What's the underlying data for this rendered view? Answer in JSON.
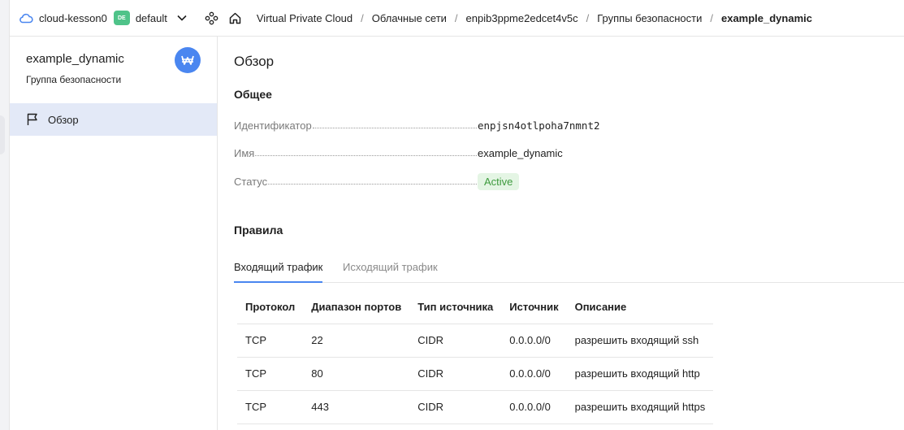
{
  "topbar": {
    "cloud_name": "cloud-kesson0",
    "folder_badge": "DE",
    "folder_name": "default",
    "breadcrumbs": [
      {
        "label": "Virtual Private Cloud"
      },
      {
        "label": "Облачные сети"
      },
      {
        "label": "enpib3ppme2edcet4v5c"
      },
      {
        "label": "Группы безопасности"
      },
      {
        "label": "example_dynamic"
      }
    ],
    "breadcrumb_separator": "/"
  },
  "sidebar": {
    "title": "example_dynamic",
    "subtitle": "Группа безопасности",
    "items": [
      {
        "label": "Обзор",
        "icon": "flag-icon",
        "active": true
      }
    ]
  },
  "main": {
    "page_title": "Обзор",
    "general": {
      "heading": "Общее",
      "properties": [
        {
          "label": "Идентификатор",
          "value": "enpjsn4otlpoha7nmnt2"
        },
        {
          "label": "Имя",
          "value": "example_dynamic"
        },
        {
          "label": "Статус",
          "value": "Active"
        }
      ]
    },
    "rules": {
      "heading": "Правила",
      "tabs": [
        {
          "label": "Входящий трафик",
          "active": true
        },
        {
          "label": "Исходящий трафик",
          "active": false
        }
      ],
      "columns": [
        "Протокол",
        "Диапазон портов",
        "Тип источника",
        "Источник",
        "Описание"
      ],
      "rows": [
        [
          "TCP",
          "22",
          "CIDR",
          "0.0.0.0/0",
          "разрешить входящий ssh"
        ],
        [
          "TCP",
          "80",
          "CIDR",
          "0.0.0.0/0",
          "разрешить входящий http"
        ],
        [
          "TCP",
          "443",
          "CIDR",
          "0.0.0.0/0",
          "разрешить входящий https"
        ]
      ]
    }
  },
  "colors": {
    "accent": "#4a86f0",
    "folder_badge": "#4fc389",
    "active_nav_bg": "#e3e9f7",
    "status_bg": "#e4f5e4",
    "status_text": "#3d9a3d"
  }
}
